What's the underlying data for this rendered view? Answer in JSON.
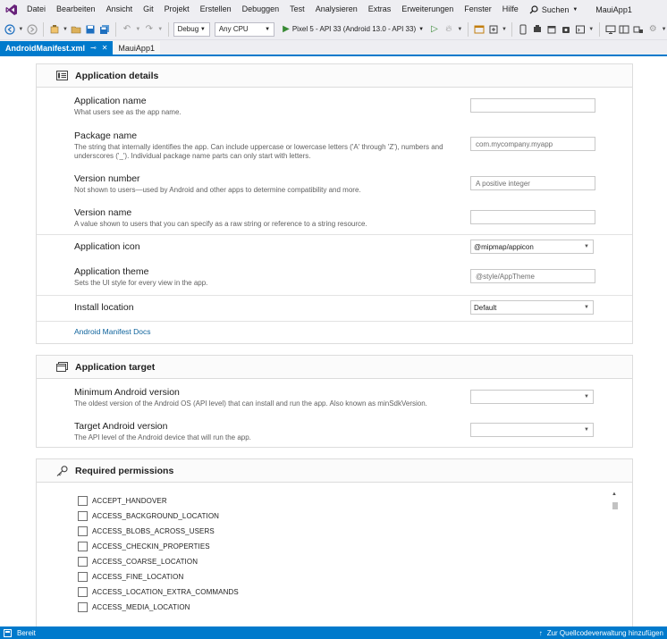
{
  "menubar": {
    "items": [
      "Datei",
      "Bearbeiten",
      "Ansicht",
      "Git",
      "Projekt",
      "Erstellen",
      "Debuggen",
      "Test",
      "Analysieren",
      "Extras",
      "Erweiterungen",
      "Fenster",
      "Hilfe"
    ],
    "search_label": "Suchen",
    "app_title": "MauiApp1"
  },
  "toolbar": {
    "configuration": "Debug",
    "platform": "Any CPU",
    "run_target": "Pixel 5 - API 33 (Android 13.0 - API 33)"
  },
  "tabs": [
    {
      "label": "AndroidManifest.xml",
      "active": true
    },
    {
      "label": "MauiApp1",
      "active": false
    }
  ],
  "app_details": {
    "title": "Application details",
    "app_name": {
      "label": "Application name",
      "desc": "What users see as the app name.",
      "value": ""
    },
    "package_name": {
      "label": "Package name",
      "desc": "The string that internally identifies the app. Can include uppercase or lowercase letters ('A' through 'Z'), numbers and underscores ('_'). Individual package name parts can only start with letters.",
      "placeholder": "com.mycompany.myapp"
    },
    "version_number": {
      "label": "Version number",
      "desc": "Not shown to users—used by Android and other apps to determine compatibility and more.",
      "placeholder": "A positive integer"
    },
    "version_name": {
      "label": "Version name",
      "desc": "A value shown to users that you can specify as a raw string or reference to a string resource.",
      "value": ""
    },
    "app_icon": {
      "label": "Application icon",
      "value": "@mipmap/appicon"
    },
    "app_theme": {
      "label": "Application theme",
      "desc": "Sets the UI style for every view in the app.",
      "placeholder": "@style/AppTheme"
    },
    "install_location": {
      "label": "Install location",
      "value": "Default"
    },
    "docs_link": "Android Manifest Docs"
  },
  "app_target": {
    "title": "Application target",
    "min_version": {
      "label": "Minimum Android version",
      "desc": "The oldest version of the Android OS (API level) that can install and run the app. Also known as minSdkVersion.",
      "value": ""
    },
    "target_version": {
      "label": "Target Android version",
      "desc": "The API level of the Android device that will run the app.",
      "value": ""
    }
  },
  "permissions": {
    "title": "Required permissions",
    "items": [
      "ACCEPT_HANDOVER",
      "ACCESS_BACKGROUND_LOCATION",
      "ACCESS_BLOBS_ACROSS_USERS",
      "ACCESS_CHECKIN_PROPERTIES",
      "ACCESS_COARSE_LOCATION",
      "ACCESS_FINE_LOCATION",
      "ACCESS_LOCATION_EXTRA_COMMANDS",
      "ACCESS_MEDIA_LOCATION"
    ]
  },
  "statusbar": {
    "left": "Bereit",
    "right": "Zur Quellcodeverwaltung hinzufügen"
  },
  "colors": {
    "accent": "#007acc",
    "link": "#0e639c",
    "run": "#388a34"
  }
}
